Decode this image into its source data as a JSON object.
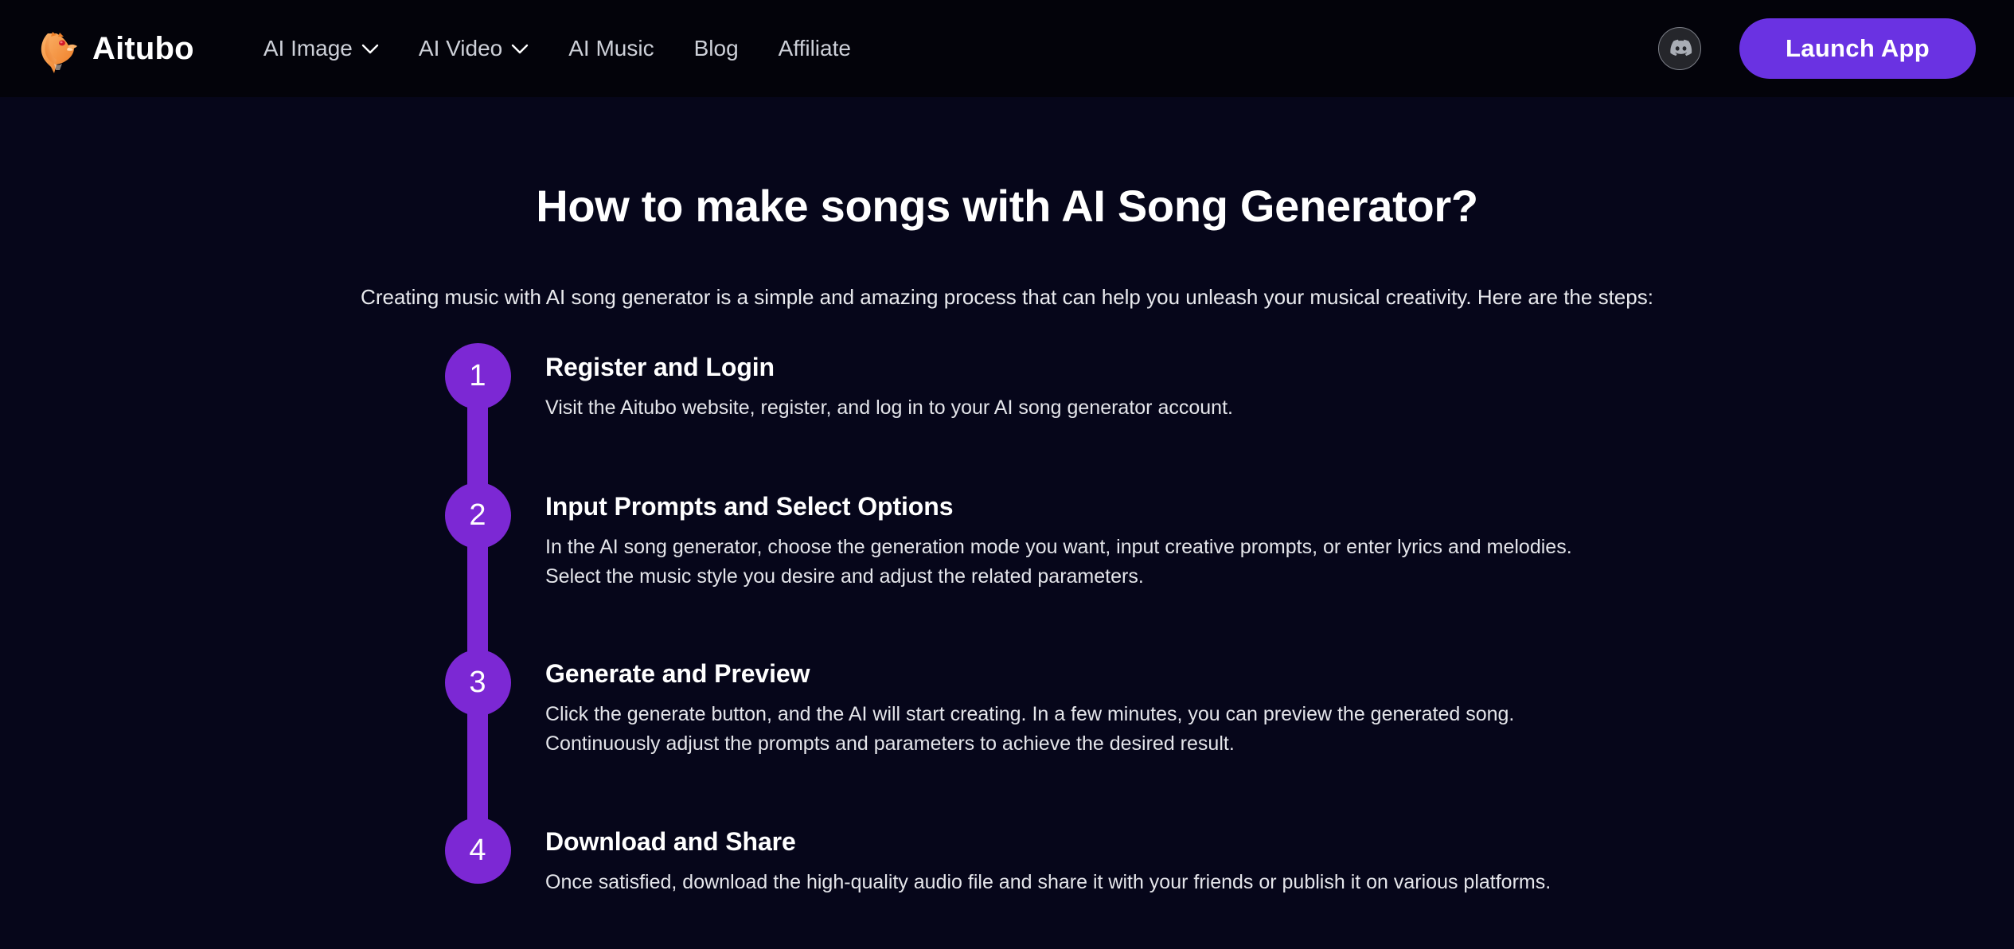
{
  "header": {
    "brand": {
      "name": "Aitubo",
      "logo_icon": "aitubo-mascot-logo",
      "logo_color": "#f08a3c"
    },
    "nav": [
      {
        "label": "AI Image",
        "has_dropdown": true,
        "icon": "chevron-down-icon"
      },
      {
        "label": "AI Video",
        "has_dropdown": true,
        "icon": "chevron-down-icon"
      },
      {
        "label": "AI Music",
        "has_dropdown": false
      },
      {
        "label": "Blog",
        "has_dropdown": false
      },
      {
        "label": "Affiliate",
        "has_dropdown": false
      }
    ],
    "discord": {
      "icon": "discord-icon",
      "label": "Discord"
    },
    "cta": {
      "label": "Launch App",
      "color": "#6a32e2"
    }
  },
  "main": {
    "title": "How to make songs with AI Song Generator?",
    "subtitle": "Creating music with AI song generator is a simple and amazing process that can help you unleash your musical creativity. Here are the steps:",
    "accent_color": "#7c28d4",
    "steps": [
      {
        "number": "1",
        "title": "Register and Login",
        "description": "Visit the Aitubo website, register, and log in to your AI song generator account."
      },
      {
        "number": "2",
        "title": "Input Prompts and Select Options",
        "description": "In the AI song generator, choose the generation mode you want, input creative prompts, or enter lyrics and melodies. Select the music style you desire and adjust the related parameters."
      },
      {
        "number": "3",
        "title": "Generate and Preview",
        "description": "Click the generate button, and the AI will start creating. In a few minutes, you can preview the generated song. Continuously adjust the prompts and parameters to achieve the desired result."
      },
      {
        "number": "4",
        "title": "Download and Share",
        "description": "Once satisfied, download the high-quality audio file and share it with your friends or publish it on various platforms."
      }
    ]
  }
}
